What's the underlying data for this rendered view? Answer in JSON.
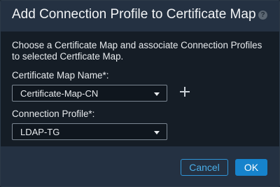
{
  "dialog": {
    "title": "Add Connection Profile to Certificate Map",
    "help_icon": "question-icon",
    "description": "Choose a Certificate Map and associate Connection Profiles to selected Certficate Map."
  },
  "fields": {
    "certificate_map": {
      "label": "Certificate Map Name*:",
      "value": "Certificate-Map-CN"
    },
    "add_icon": "plus-icon",
    "connection_profile": {
      "label": "Connection Profile*:",
      "value": "LDAP-TG"
    }
  },
  "footer": {
    "cancel_label": "Cancel",
    "ok_label": "OK"
  },
  "colors": {
    "header_bg": "#243142",
    "body_bg": "#151d26",
    "accent": "#1683cc"
  }
}
